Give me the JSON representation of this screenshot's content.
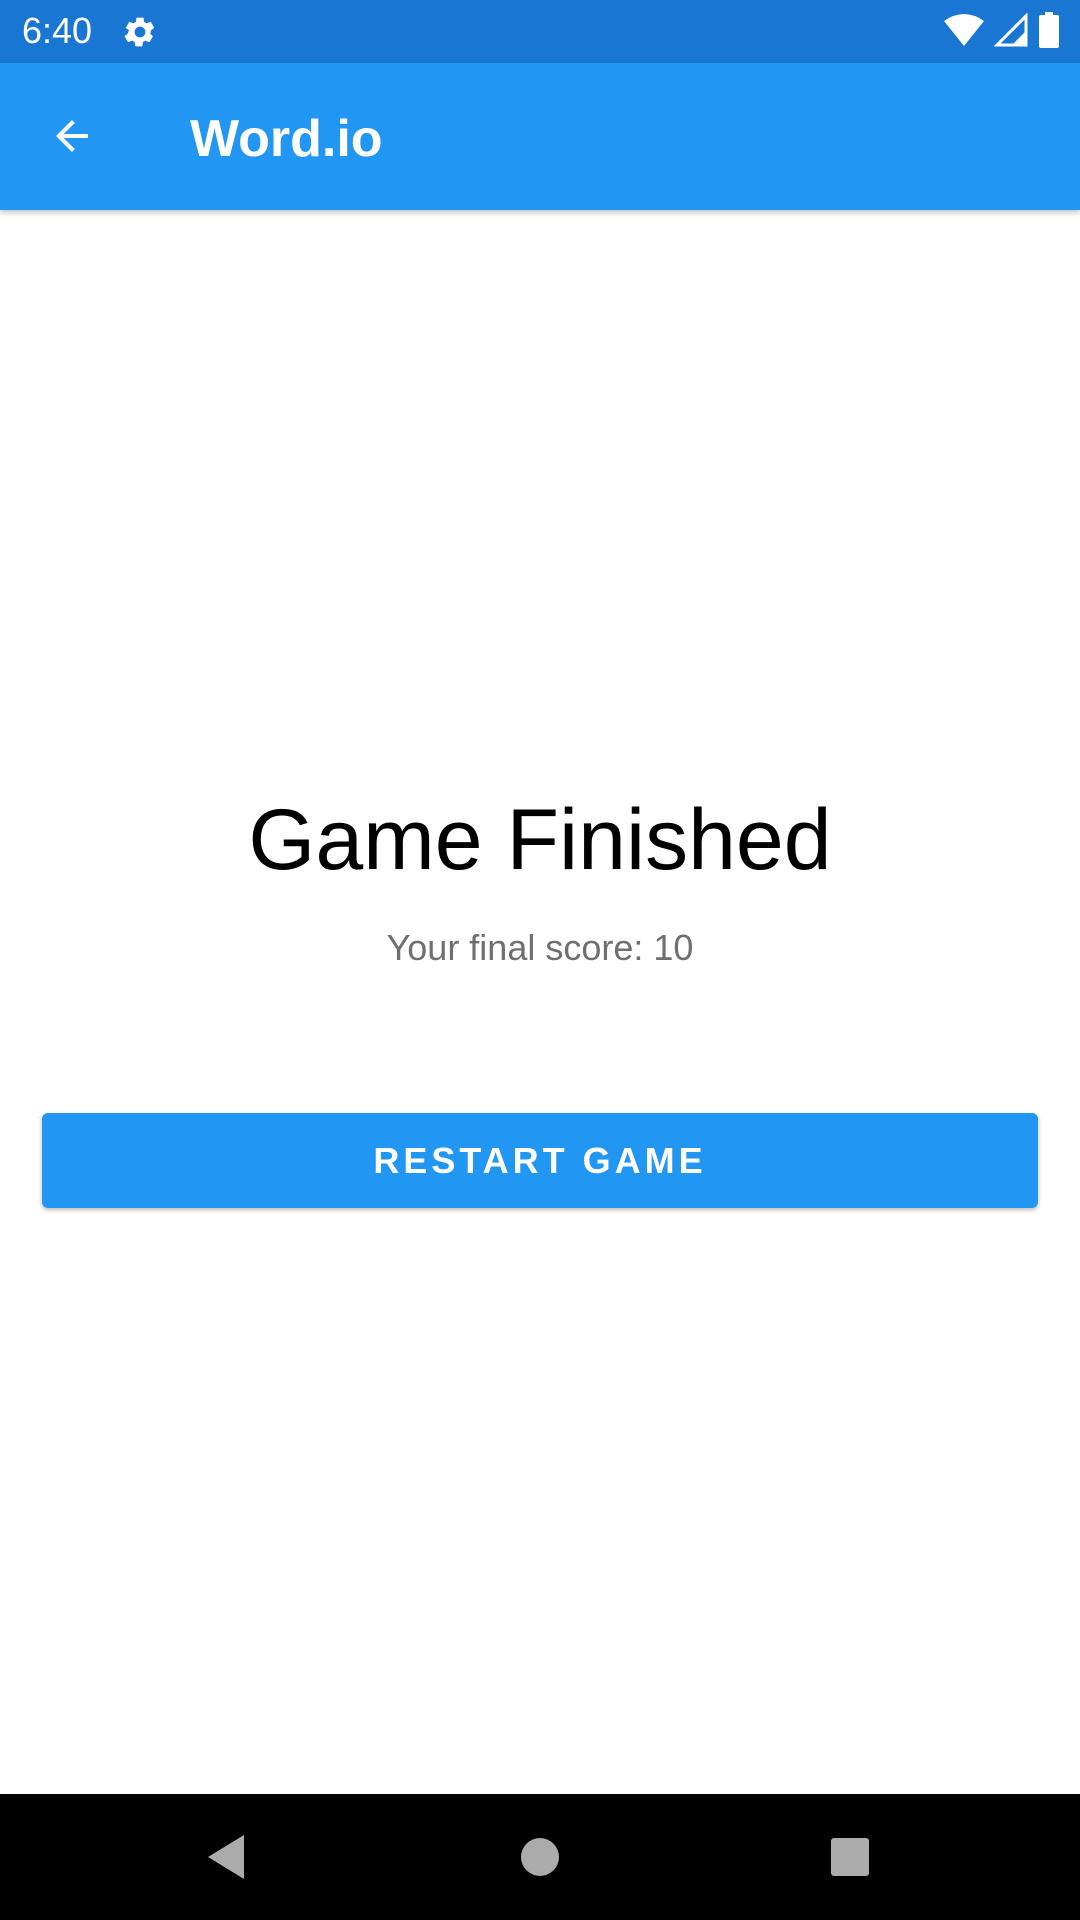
{
  "status_bar": {
    "time": "6:40",
    "icons": [
      "settings-icon",
      "wifi-icon",
      "cellular-signal-icon",
      "battery-icon"
    ],
    "background": "#1976d2"
  },
  "app_bar": {
    "title": "Word.io",
    "back_icon": "arrow-back-icon",
    "background": "#2196f3"
  },
  "main": {
    "headline": "Game Finished",
    "score_text": "Your final score: 10",
    "restart_label": "RESTART GAME"
  },
  "nav_bar": {
    "icons": [
      "back-triangle-icon",
      "home-circle-icon",
      "recents-square-icon"
    ]
  }
}
